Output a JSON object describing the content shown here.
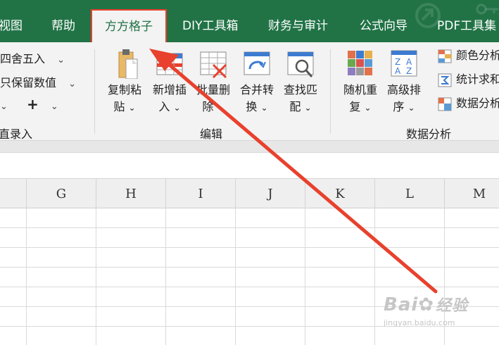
{
  "tabs": [
    {
      "label": "视图"
    },
    {
      "label": "帮助"
    },
    {
      "label": "方方格子"
    },
    {
      "label": "DIY工具箱"
    },
    {
      "label": "财务与审计"
    },
    {
      "label": "公式向导"
    },
    {
      "label": "PDF工具集"
    }
  ],
  "left_group": {
    "round_label": "四舍五入",
    "keep_value_label": "只保留数值",
    "plus_symbol": "+",
    "group_label": "直录入"
  },
  "edit_group": {
    "buttons": [
      {
        "line1": "复制粘",
        "line2": "贴"
      },
      {
        "line1": "新增插",
        "line2": "入"
      },
      {
        "line1": "批量删",
        "line2": "除"
      },
      {
        "line1": "合并转",
        "line2": "换"
      },
      {
        "line1": "查找匹",
        "line2": "配"
      }
    ],
    "group_label": "编辑"
  },
  "analysis_group": {
    "buttons": [
      {
        "line1": "随机重",
        "line2": "复"
      },
      {
        "line1": "高级排",
        "line2": "序"
      }
    ],
    "small_items": [
      {
        "label": "颜色分析"
      },
      {
        "label": "统计求和"
      },
      {
        "label": "数据分析"
      }
    ],
    "group_label": "数据分析"
  },
  "dropdown_glyph": "⌄",
  "columns": [
    "G",
    "H",
    "I",
    "J",
    "K",
    "L",
    "M"
  ],
  "watermark": {
    "brand": "Bai",
    "brand2": "经验",
    "sub": "jingyan.baidu.com"
  },
  "colors": {
    "tab_bg": "#217346",
    "ribbon_bg": "#f3f3f3",
    "highlight": "#e8412d"
  }
}
